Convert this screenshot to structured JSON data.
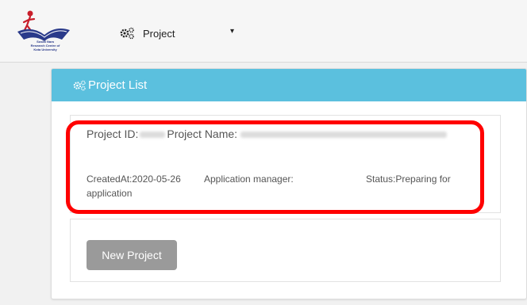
{
  "header": {
    "logo": {
      "icon": "organization-logo",
      "text_lines": [
        "Sosial Nara",
        "Research Centre of",
        "Kota University"
      ]
    },
    "nav": {
      "project_label": "Project",
      "gears_icon": "gears-icon",
      "caret": "▾"
    }
  },
  "panel": {
    "title": "Project List",
    "heading_color": "#5bc0de",
    "project": {
      "id_label": "Project ID:",
      "name_label": "Project Name:",
      "created_label": "CreatedAt:2020-05-26",
      "manager_label": "Application manager:",
      "status_label": "Status:Preparing for",
      "status_cont": "application"
    },
    "new_project_button": "New Project"
  },
  "annotation": {
    "highlight_color": "#ff0000"
  }
}
